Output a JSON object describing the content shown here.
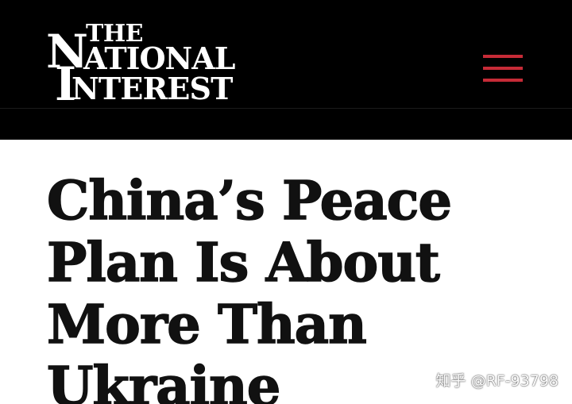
{
  "header": {
    "logo": {
      "line1": "THE",
      "line2_initial": "N",
      "line2_rest": "ATIONAL",
      "line3_initial": "I",
      "line3_rest": "NTEREST"
    },
    "menu_icon": "hamburger-menu-icon",
    "menu_color": "#c62b37",
    "background": "#000000"
  },
  "article": {
    "headline_lines": [
      "China’s Peace",
      "Plan Is About",
      "More Than",
      "Ukraine"
    ]
  },
  "watermark": "知乎 @RF-93798"
}
